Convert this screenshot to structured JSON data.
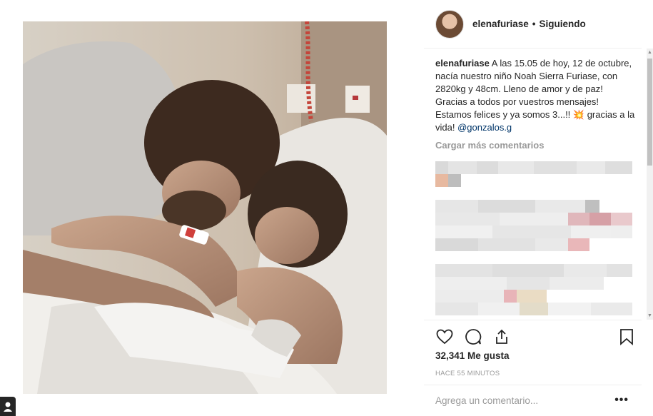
{
  "post": {
    "image_alt": "Couple embracing in hospital bed with newborn",
    "username": "elenafuriase",
    "separator": "•",
    "follow_status": "Siguiendo"
  },
  "caption": {
    "user": "elenafuriase",
    "text": " A las 15.05 de hoy, 12 de octubre, nacía nuestro niño Noah Sierra Furiase, con 2820kg y 48cm. Lleno de amor y de paz! Gracias a todos por vuestros mensajes! Estamos felices y ya somos 3...!! ",
    "emoji": "💥",
    "text_end": " gracias a la vida! ",
    "mention": "@gonzalos.g"
  },
  "comments": {
    "load_more": "Cargar más comentarios",
    "blurred": true
  },
  "actions": {
    "like_icon": "heart-icon",
    "comment_icon": "speech-bubble-icon",
    "share_icon": "share-icon",
    "save_icon": "bookmark-icon",
    "likes": "32,341 Me gusta",
    "time": "HACE 55 MINUTOS",
    "comment_placeholder": "Agrega un comentario...",
    "more": "•••"
  },
  "colors": {
    "text": "#262626",
    "muted": "#999999",
    "mention": "#003569",
    "border": "#efefef"
  }
}
